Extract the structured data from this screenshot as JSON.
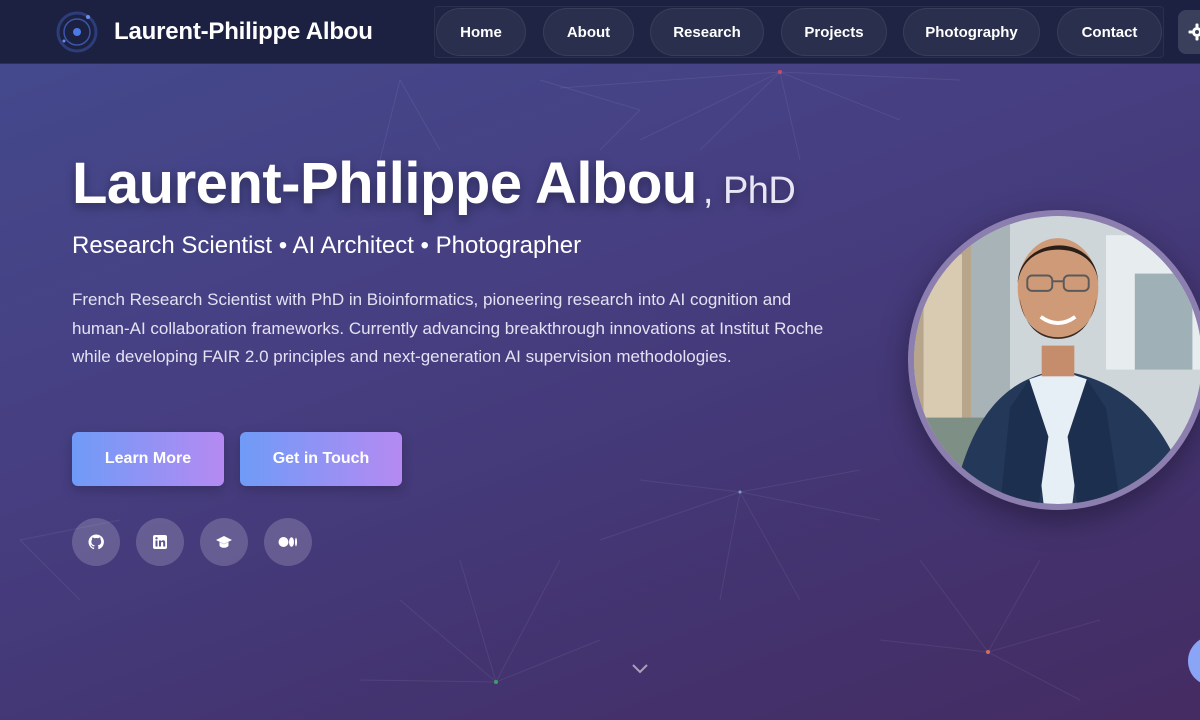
{
  "header": {
    "brand_name": "Laurent-Philippe Albou",
    "nav": [
      {
        "label": "Home"
      },
      {
        "label": "About"
      },
      {
        "label": "Research"
      },
      {
        "label": "Projects"
      },
      {
        "label": "Photography"
      },
      {
        "label": "Contact"
      }
    ],
    "theme_toggle_icon": "gear-icon"
  },
  "hero": {
    "name": "Laurent-Philippe Albou",
    "suffix": ", PhD",
    "tagline": "Research Scientist • AI Architect • Photographer",
    "bio": "French Research Scientist with PhD in Bioinformatics, pioneering research into AI cognition and human-AI collaboration frameworks. Currently advancing breakthrough innovations at Institut Roche while developing FAIR 2.0 principles and next-generation AI supervision methodologies.",
    "buttons": {
      "learn_more": "Learn More",
      "get_in_touch": "Get in Touch"
    },
    "social_icons": [
      "github-icon",
      "linkedin-icon",
      "graduation-cap-icon",
      "medium-icon"
    ]
  },
  "colors": {
    "button_gradient_start": "#6f9bf7",
    "button_gradient_end": "#b58af2",
    "header_bg": "#1c2041",
    "page_bg": "#463f82"
  }
}
